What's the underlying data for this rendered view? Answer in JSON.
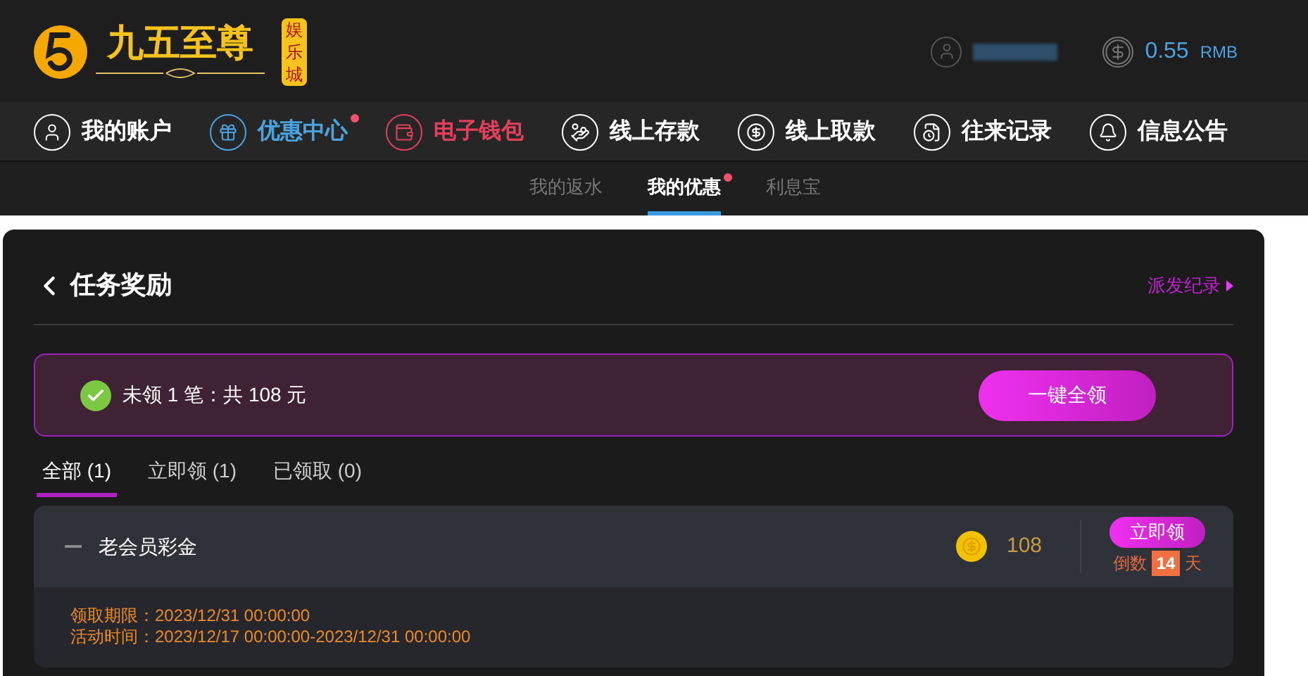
{
  "brand": {
    "name": "九五至尊",
    "tag": "娱乐城"
  },
  "account": {
    "balance": "0.55",
    "currency": "RMB"
  },
  "nav": [
    {
      "label": "我的账户",
      "kind": "user",
      "color": "#ffffff",
      "dot": false
    },
    {
      "label": "优惠中心",
      "kind": "gift",
      "color": "#4aa3df",
      "dot": true
    },
    {
      "label": "电子钱包",
      "kind": "wallet",
      "color": "#e0405a",
      "dot": false
    },
    {
      "label": "线上存款",
      "kind": "deposit",
      "color": "#ffffff",
      "dot": false
    },
    {
      "label": "线上取款",
      "kind": "withdraw",
      "color": "#ffffff",
      "dot": false
    },
    {
      "label": "往来记录",
      "kind": "records",
      "color": "#ffffff",
      "dot": false
    },
    {
      "label": "信息公告",
      "kind": "bell",
      "color": "#ffffff",
      "dot": false
    }
  ],
  "subtabs": [
    {
      "label": "我的返水",
      "selected": false,
      "dot": false
    },
    {
      "label": "我的优惠",
      "selected": true,
      "dot": true
    },
    {
      "label": "利息宝",
      "selected": false,
      "dot": false
    }
  ],
  "panel": {
    "title": "任务奖励",
    "history_link": "派发纪录",
    "summary": {
      "text": "未领 1 笔：共 108 元",
      "button": "一键全领"
    },
    "filters": [
      {
        "label": "全部 (1)",
        "selected": true
      },
      {
        "label": "立即领 (1)",
        "selected": false
      },
      {
        "label": "已领取 (0)",
        "selected": false
      }
    ],
    "tasks": [
      {
        "title": "老会员彩金",
        "amount": "108",
        "button": "立即领",
        "countdown_label": "倒数",
        "countdown_days": "14",
        "countdown_unit": "天",
        "deadline": "领取期限：2023/12/31 00:00:00",
        "period": "活动时间：2023/12/17 00:00:00-2023/12/31 00:00:00"
      }
    ]
  }
}
